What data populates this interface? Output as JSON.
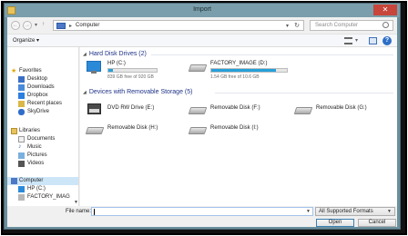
{
  "window": {
    "title": "Import"
  },
  "address_bar": {
    "breadcrumb": "Computer",
    "separator": "▸"
  },
  "search": {
    "placeholder": "Search Computer"
  },
  "toolbar": {
    "organize_label": "Organize ▾"
  },
  "sidebar": {
    "items": [
      {
        "label": "Favorites",
        "icon": "star-icon"
      },
      {
        "label": "Desktop",
        "icon": "desktop-icon"
      },
      {
        "label": "Downloads",
        "icon": "downloads-icon"
      },
      {
        "label": "Dropbox",
        "icon": "dropbox-icon"
      },
      {
        "label": "Recent places",
        "icon": "recent-places-icon"
      },
      {
        "label": "SkyDrive",
        "icon": "skydrive-icon"
      },
      {
        "label": "Libraries",
        "icon": "libraries-icon"
      },
      {
        "label": "Documents",
        "icon": "documents-icon"
      },
      {
        "label": "Music",
        "icon": "music-icon"
      },
      {
        "label": "Pictures",
        "icon": "pictures-icon"
      },
      {
        "label": "Videos",
        "icon": "videos-icon"
      },
      {
        "label": "Computer",
        "icon": "computer-icon"
      },
      {
        "label": "HP (C:)",
        "icon": "drive-icon"
      },
      {
        "label": "FACTORY_IMAG",
        "icon": "drive-icon"
      }
    ]
  },
  "groups": {
    "hard_disk_drives": "Hard Disk Drives (2)",
    "removable_storage": "Devices with Removable Storage (5)"
  },
  "hard_drives": [
    {
      "name": "HP (C:)",
      "space": "839 GB free of 920 GB",
      "used_fraction": 0.09
    },
    {
      "name": "FACTORY_IMAGE (D:)",
      "space": "1.54 GB free of 10.6 GB",
      "used_fraction": 0.85
    }
  ],
  "removable_drives": [
    {
      "name": "DVD RW Drive (E:)",
      "icon": "dvd-drive-icon"
    },
    {
      "name": "Removable Disk (F:)",
      "icon": "removable-disk-icon"
    },
    {
      "name": "Removable Disk (G:)",
      "icon": "removable-disk-icon"
    },
    {
      "name": "Removable Disk (H:)",
      "icon": "removable-disk-icon"
    },
    {
      "name": "Removable Disk (I:)",
      "icon": "removable-disk-icon"
    }
  ],
  "bottom": {
    "file_name_label": "File name:",
    "file_name_value": "",
    "filter": "All Supported Formats",
    "open_label": "Open",
    "cancel_label": "Cancel"
  },
  "colors": {
    "title_bar": "#7a9eab",
    "close_button": "#c7453a",
    "group_header": "#1e3287",
    "capacity_fill": "#26a0da"
  }
}
